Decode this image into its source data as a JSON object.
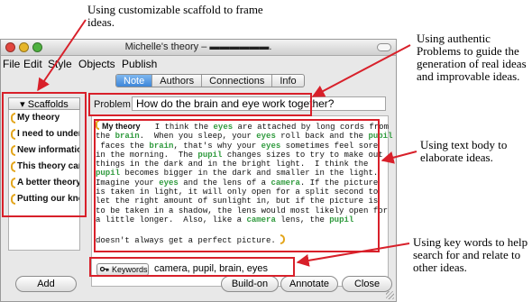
{
  "annotations": {
    "top": "Using customizable scaffold to frame ideas.",
    "right_problem": "Using authentic Problems to guide the generation of real ideas and improvable ideas.",
    "right_body": "Using text body to elaborate ideas.",
    "right_keywords": "Using key words to help search for and relate to other ideas."
  },
  "window": {
    "title": "Michelle's theory – ▬▬▬▬▬▬.",
    "menus": [
      "File",
      "Edit",
      "Style",
      "Objects",
      "Publish"
    ],
    "tabs": [
      "Note",
      "Authors",
      "Connections",
      "Info"
    ],
    "active_tab": "Note"
  },
  "sidebar": {
    "header": "Scaffolds",
    "items": [
      "My theory",
      "I need to unders",
      "New information",
      "This theory cann",
      "A better theory",
      "Putting our know"
    ],
    "add_label": "Add"
  },
  "problem": {
    "label": "Problem",
    "text": "How do the brain and eye work together?"
  },
  "note": {
    "scaffold": "My theory",
    "keywords_highlighted": [
      "eyes",
      "brain",
      "pupil",
      "camera"
    ]
  },
  "keywords": {
    "button_label": "Keywords",
    "value": "camera, pupil, brain, eyes"
  },
  "buttons": {
    "buildon": "Build-on",
    "annotate": "Annotate",
    "close": "Close"
  },
  "colors": {
    "highlight": "#d8202a",
    "scaffold_bracket": "#e3a51b",
    "keyword_text": "#2f9a3d",
    "active_tab": "#3d86d9"
  }
}
